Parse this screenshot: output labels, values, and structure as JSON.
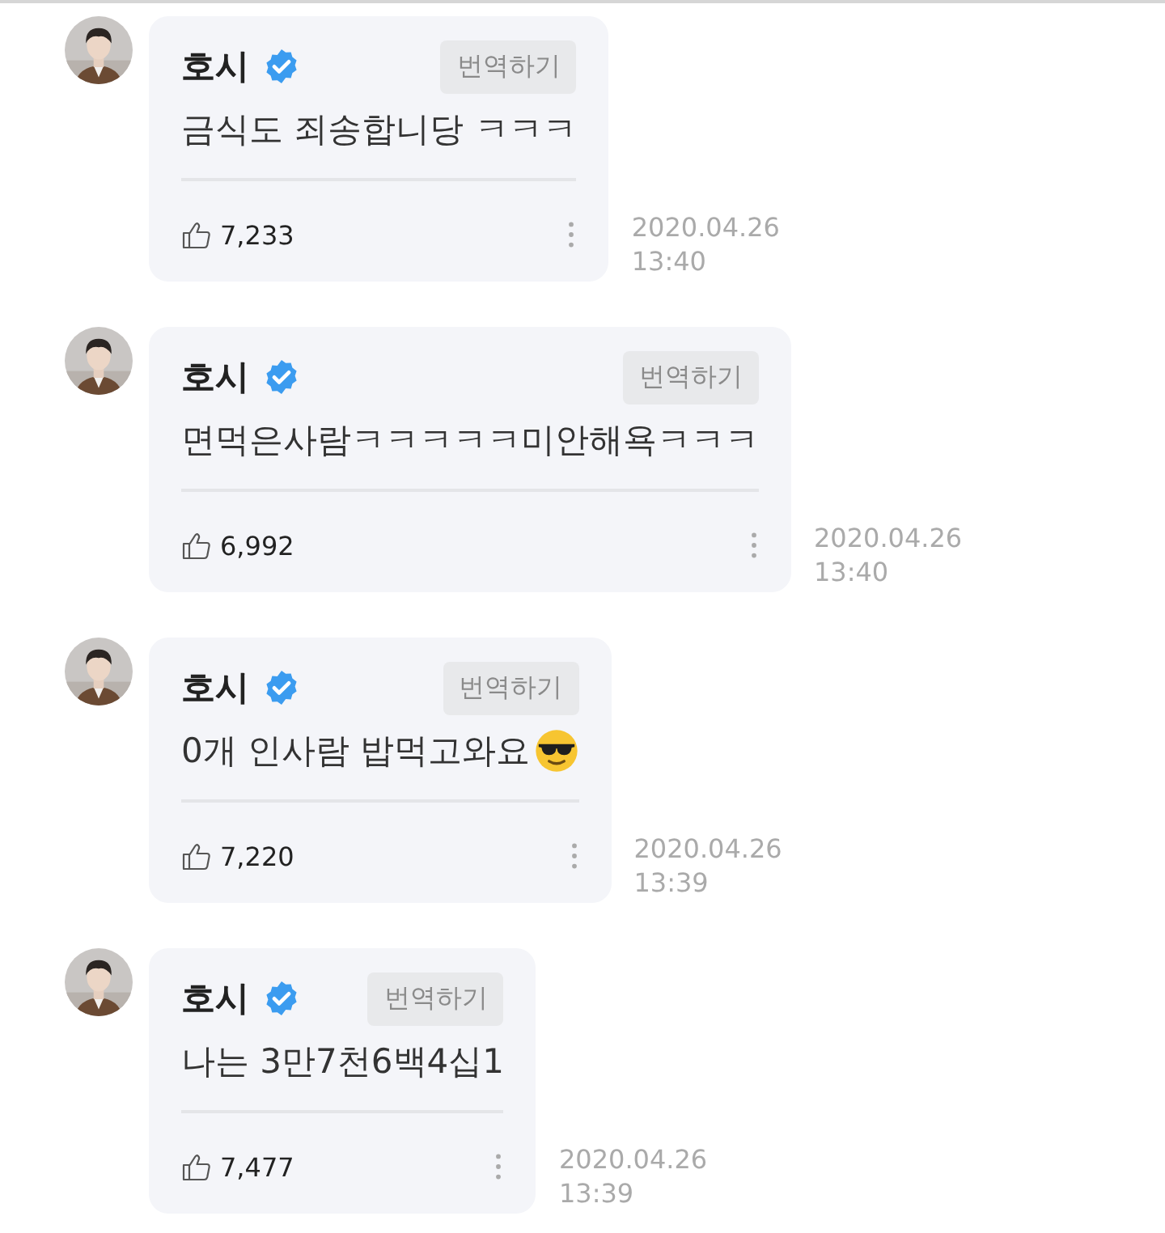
{
  "comments": [
    {
      "author": "호시",
      "verified": true,
      "translate_label": "번역하기",
      "message": "금식도 죄송합니당 ㅋㅋㅋ",
      "likes": "7,233",
      "date": "2020.04.26",
      "time": "13:40"
    },
    {
      "author": "호시",
      "verified": true,
      "translate_label": "번역하기",
      "message": "면먹은사람ㅋㅋㅋㅋㅋ미안해욕ㅋㅋㅋ",
      "likes": "6,992",
      "date": "2020.04.26",
      "time": "13:40"
    },
    {
      "author": "호시",
      "verified": true,
      "translate_label": "번역하기",
      "message": "0개 인사람 밥먹고와요",
      "sunglasses_emoji": true,
      "likes": "7,220",
      "date": "2020.04.26",
      "time": "13:39"
    },
    {
      "author": "호시",
      "verified": true,
      "translate_label": "번역하기",
      "message": "나는 3만7천6백4십1",
      "likes": "7,477",
      "date": "2020.04.26",
      "time": "13:39"
    }
  ]
}
